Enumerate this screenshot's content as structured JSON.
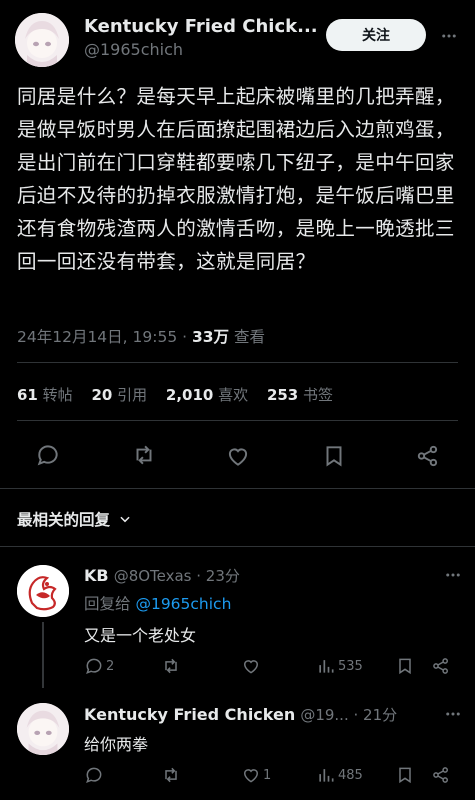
{
  "post": {
    "author_name": "Kentucky Fried Chick...",
    "author_handle": "@1965chich",
    "follow_label": "关注",
    "text": "同居是什么？是每天早上起床被嘴里的几把弄醒，是做早饭时男人在后面撩起围裙边后入边煎鸡蛋，是出门前在门口穿鞋都要嗦几下纽子，是中午回家后迫不及待的扔掉衣服激情打炮，是午饭后嘴巴里还有食物残渣两人的激情舌吻，是晚上一晚透批三回一回还没有带套，这就是同居？",
    "timestamp": "24年12月14日, 19:55 ·",
    "views_count": "33万",
    "views_label": "查看"
  },
  "stats": {
    "reposts_count": "61",
    "reposts_label": "转帖",
    "quotes_count": "20",
    "quotes_label": "引用",
    "likes_count": "2,010",
    "likes_label": "喜欢",
    "bookmarks_count": "253",
    "bookmarks_label": "书签"
  },
  "replies_header": {
    "label": "最相关的回复"
  },
  "replies": [
    {
      "name": "KB",
      "handle": "@8OTexas · 23分",
      "reply_to_prefix": "回复给",
      "reply_to_handle": "@1965chich",
      "text": "又是一个老处女",
      "reply_count": "2",
      "views": "535"
    },
    {
      "name": "Kentucky Fried Chicken",
      "handle": "@19... · 21分",
      "text": "给你两拳",
      "like_count": "1",
      "views": "485"
    }
  ],
  "colors": {
    "background": "#000000",
    "text": "#e7e9ea",
    "muted": "#71767b",
    "link": "#1d9bf0"
  },
  "icons": [
    "reply-icon",
    "repost-icon",
    "like-icon",
    "bookmark-icon",
    "share-icon",
    "views-icon",
    "chevron-down-icon"
  ]
}
